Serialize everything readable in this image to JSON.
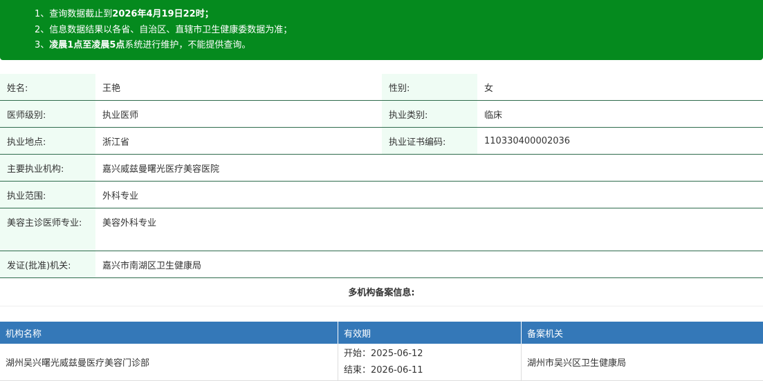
{
  "notice": {
    "line1_prefix": "1、查询数据截止到",
    "line1_bold": "2026年4月19日22时",
    "line1_suffix": "；",
    "line2": "2、信息数据结果以各省、自治区、直辖市卫生健康委数据为准；",
    "line3_prefix": "3、",
    "line3_bold": "凌晨1点至凌晨5点",
    "line3_suffix": "系统进行维护，不能提供查询。"
  },
  "doctor": {
    "name_label": "姓名:",
    "name": "王艳",
    "gender_label": "性别:",
    "gender": "女",
    "level_label": "医师级别:",
    "level": "执业医师",
    "category_label": "执业类别:",
    "category": "临床",
    "location_label": "执业地点:",
    "location": "浙江省",
    "cert_label": "执业证书编码:",
    "cert": "110330400002036",
    "institution_label": "主要执业机构:",
    "institution": "嘉兴威兹曼曙光医疗美容医院",
    "scope_label": "执业范围:",
    "scope": "外科专业",
    "cosmetic_label": "美容主诊医师专业:",
    "cosmetic": "美容外科专业",
    "issuer_label": "发证(批准)机关:",
    "issuer": "嘉兴市南湖区卫生健康局"
  },
  "filing": {
    "title": "多机构备案信息:",
    "headers": [
      "机构名称",
      "有效期",
      "备案机关"
    ],
    "rows": [
      {
        "institution": "湖州吴兴曙光威兹曼医疗美容门诊部",
        "start": "开始：2025-06-12",
        "end": "结束：2026-06-11",
        "authority": "湖州市吴兴区卫生健康局"
      }
    ]
  },
  "colors": {
    "notice_bg": "#058a1e",
    "label_bg": "#effcf4",
    "table_header_bg": "#3478b8"
  }
}
